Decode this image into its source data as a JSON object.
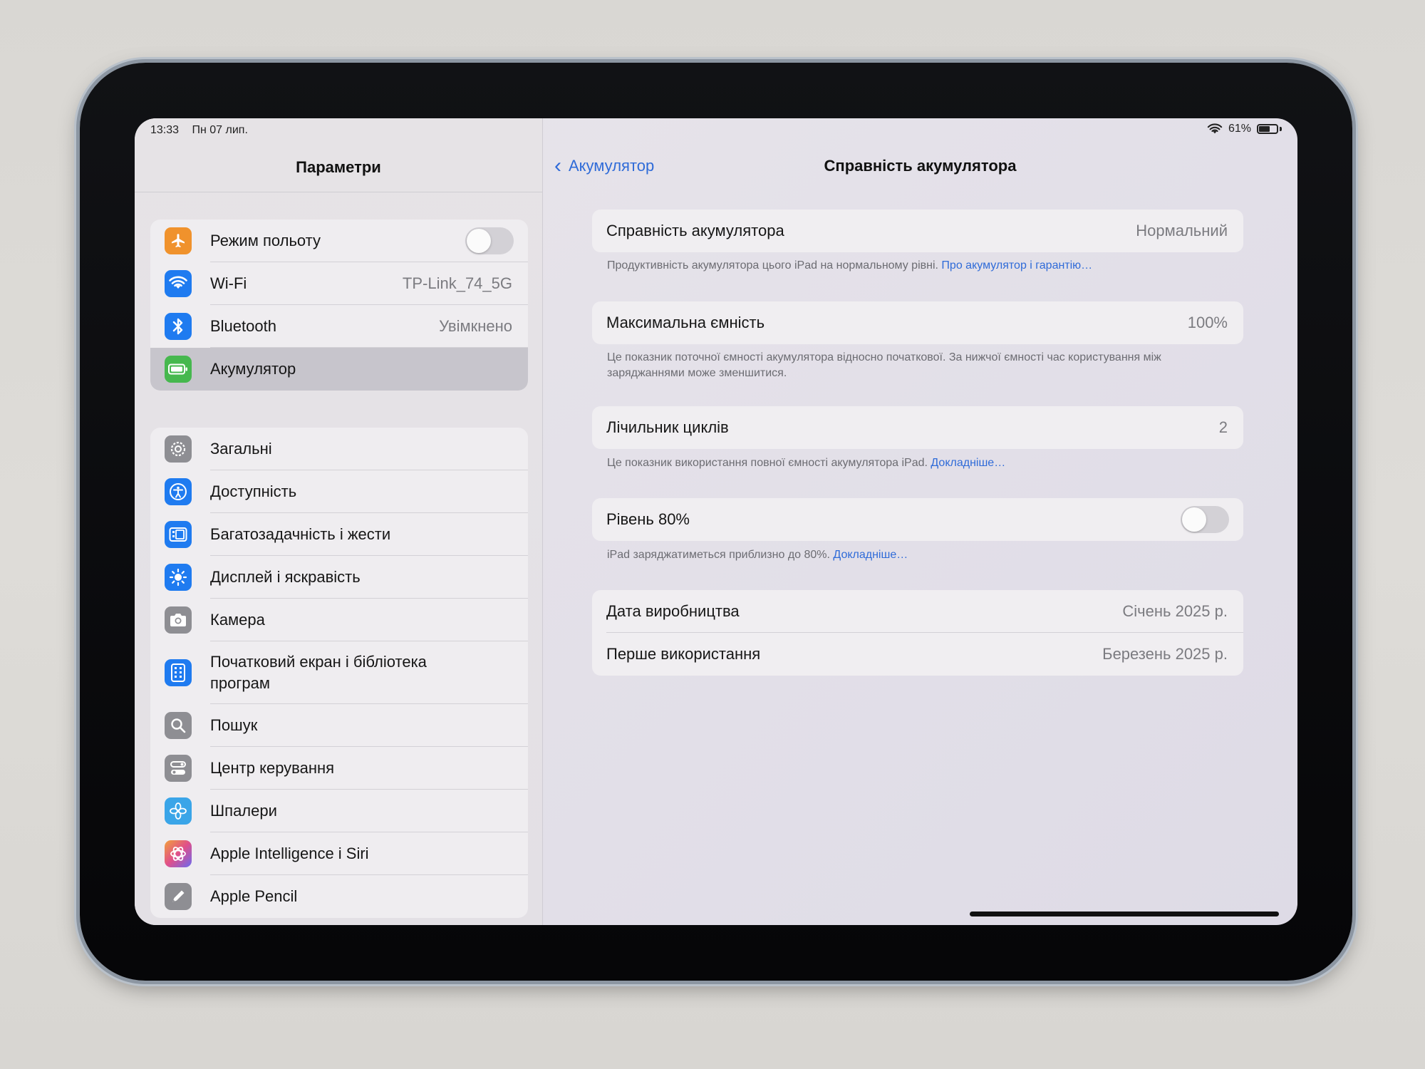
{
  "status": {
    "time": "13:33",
    "date": "Пн 07 лип.",
    "battery": "61%"
  },
  "sidebar": {
    "title": "Параметри",
    "group1": [
      {
        "label": "Режим польоту",
        "icon": "airplane-icon",
        "color": "#f0922c",
        "toggle": false
      },
      {
        "label": "Wi-Fi",
        "value": "TP-Link_74_5G",
        "icon": "wifi-icon",
        "color": "#1f7bf0"
      },
      {
        "label": "Bluetooth",
        "value": "Увімкнено",
        "icon": "bluetooth-icon",
        "color": "#1f7bf0"
      },
      {
        "label": "Акумулятор",
        "icon": "battery-icon",
        "color": "#46b84e",
        "selected": true
      }
    ],
    "group2": [
      {
        "label": "Загальні",
        "icon": "gear-icon",
        "color": "#8e8e93"
      },
      {
        "label": "Доступність",
        "icon": "accessibility-icon",
        "color": "#1f7bf0"
      },
      {
        "label": "Багатозадачність і жести",
        "icon": "multitasking-icon",
        "color": "#1f7bf0"
      },
      {
        "label": "Дисплей і яскравість",
        "icon": "brightness-icon",
        "color": "#1f7bf0"
      },
      {
        "label": "Камера",
        "icon": "camera-icon",
        "color": "#8e8e93"
      },
      {
        "label": "Початковий екран і бібліотека програм",
        "icon": "home-screen-icon",
        "color": "#1f7bf0"
      },
      {
        "label": "Пошук",
        "icon": "search-icon",
        "color": "#8e8e93"
      },
      {
        "label": "Центр керування",
        "icon": "control-center-icon",
        "color": "#8e8e93"
      },
      {
        "label": "Шпалери",
        "icon": "wallpaper-icon",
        "color": "#3aa5e8"
      },
      {
        "label": "Apple Intelligence і Siri",
        "icon": "siri-icon",
        "color": "#d46ad0"
      },
      {
        "label": "Apple Pencil",
        "icon": "pencil-icon",
        "color": "#8e8e93"
      }
    ]
  },
  "detail": {
    "back_label": "Акумулятор",
    "title": "Справність акумулятора",
    "health": {
      "label": "Справність акумулятора",
      "value": "Нормальний"
    },
    "health_note": "Продуктивність акумулятора цього iPad на нормальному рівні.",
    "health_link": "Про акумулятор і гарантію…",
    "capacity": {
      "label": "Максимальна ємність",
      "value": "100%"
    },
    "capacity_note": "Це показник поточної ємності акумулятора відносно початкової. За нижчої ємності час користування між заряджаннями може зменшитися.",
    "cycles": {
      "label": "Лічильник циклів",
      "value": "2"
    },
    "cycles_note": "Це показник використання повної ємності акумулятора iPad.",
    "cycles_link": "Докладніше…",
    "limit": {
      "label": "Рівень 80%",
      "toggle": false
    },
    "limit_note": "iPad заряджатиметься приблизно до 80%.",
    "limit_link": "Докладніше…",
    "manufacture": {
      "label": "Дата виробництва",
      "value": "Січень 2025 р."
    },
    "first_use": {
      "label": "Перше використання",
      "value": "Березень 2025 р."
    }
  }
}
